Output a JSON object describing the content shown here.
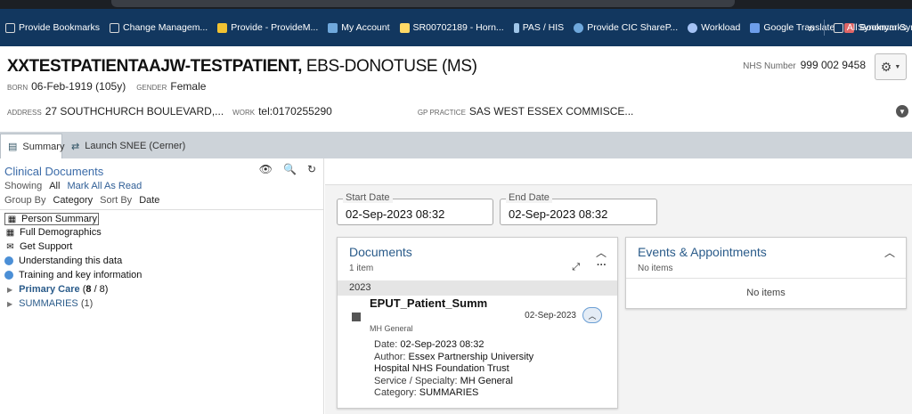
{
  "bookmarks": [
    {
      "label": "Provide Bookmarks",
      "icon": "folder-icon",
      "color": "#d9d9d9"
    },
    {
      "label": "Change Managem...",
      "icon": "folder-icon",
      "color": "#d9d9d9"
    },
    {
      "label": "Provide - ProvideM...",
      "icon": "star-folder-icon",
      "color": "#f1c232"
    },
    {
      "label": "My Account",
      "icon": "account-icon",
      "color": "#6fa8dc"
    },
    {
      "label": "SR00702189 - Horn...",
      "icon": "ticket-icon",
      "color": "#ffd966"
    },
    {
      "label": "PAS / HIS",
      "icon": "pas-icon",
      "color": "#9fc5e8"
    },
    {
      "label": "Provide CIC ShareP...",
      "icon": "sharepoint-icon",
      "color": "#6fa8dc"
    },
    {
      "label": "Workload",
      "icon": "workload-icon",
      "color": "#a4c2f4"
    },
    {
      "label": "Google Translate",
      "icon": "translate-icon",
      "color": "#6d9eeb"
    },
    {
      "label": "Synonym Synonyms...",
      "icon": "synonym-icon",
      "color": "#e06666"
    }
  ],
  "bookmarks_overflow": "»",
  "all_bookmarks": "All Bookmarks",
  "patient": {
    "name_bold": "XXTESTPATIENTAAJW-TESTPATIENT,",
    "name_rest": " EBS-DONOTUSE (MS)",
    "born_label": "BORN",
    "born_value": "06-Feb-1919 (105y)",
    "gender_label": "GENDER",
    "gender_value": "Female",
    "address_label": "ADDRESS",
    "address_value": "27 SOUTHCHURCH BOULEVARD,...",
    "work_label": "WORK",
    "work_value": "tel:0170255290",
    "gp_label": "GP PRACTICE",
    "gp_value": "SAS WEST ESSEX COMMISCE...",
    "nhs_label": "NHS Number",
    "nhs_value": "999 002 9458"
  },
  "tabs": [
    {
      "label": "Summary",
      "icon": "summary-icon"
    },
    {
      "label": "Launch SNEE (Cerner)",
      "icon": "swap-icon"
    }
  ],
  "left": {
    "heading": "Clinical Documents",
    "showing_label": "Showing",
    "showing_value": "All",
    "mark_all": "Mark All As Read",
    "group_label": "Group By",
    "group_value": "Category",
    "sort_label": "Sort By",
    "sort_value": "Date",
    "items": [
      {
        "label": "Person Summary",
        "icon": "grid-icon"
      },
      {
        "label": "Full Demographics",
        "icon": "grid-icon"
      },
      {
        "label": "Get Support",
        "icon": "envelope-icon"
      },
      {
        "label": "Understanding this data",
        "icon": "info-icon"
      },
      {
        "label": "Training and key information",
        "icon": "info-icon"
      }
    ],
    "tree": [
      {
        "label": "Primary Care",
        "count_open": " (",
        "count_bold": "8",
        "count_close": " / 8)"
      },
      {
        "label": "SUMMARIES",
        "count": " (1)"
      }
    ]
  },
  "dates": {
    "start_label": "Start Date",
    "start_value": "02-Sep-2023 08:32",
    "end_label": "End Date",
    "end_value": "02-Sep-2023 08:32"
  },
  "documents": {
    "title": "Documents",
    "count": "1 item",
    "year": "2023",
    "doc_title": "EPUT_Patient_Summ",
    "doc_date": "02-Sep-2023",
    "doc_sub": "MH General",
    "date_label": "Date:",
    "date_value": "02-Sep-2023 08:32",
    "author_label": "Author:",
    "author_value": "Essex Partnership University",
    "author_value2": "Hospital NHS Foundation Trust",
    "service_label": "Service / Specialty:",
    "service_value": "MH General",
    "category_label": "Category:",
    "category_value": "SUMMARIES"
  },
  "events": {
    "title": "Events & Appointments",
    "count": "No items",
    "empty": "No items"
  }
}
